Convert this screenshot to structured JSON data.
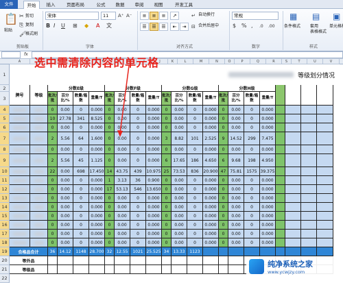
{
  "tabs": {
    "file": "文件",
    "home": "开始",
    "insert": "插入",
    "layout": "页面布局",
    "formula": "公式",
    "data": "数据",
    "review": "审阅",
    "view": "视图",
    "dev": "开发工具"
  },
  "ribbon": {
    "paste": "粘贴",
    "cut": "剪切",
    "copy": "复制",
    "format_painter": "格式刷",
    "clipboard_group": "剪贴板",
    "font_name": "宋体",
    "font_size": "11",
    "font_group": "字体",
    "align_group": "对齐方式",
    "wrap_text": "自动换行",
    "merge_center": "合并后居中",
    "number_format": "常规",
    "number_group": "数字",
    "cond_format": "条件格式",
    "table_format": "套用\n表格格式",
    "cell_style": "单元格样式",
    "styles_group": "样式"
  },
  "formula_bar": {
    "fx": "fx"
  },
  "annotation": "选中需清除内容的单元格",
  "sheet": {
    "title": "等级划分情况",
    "col_brand": "牌号",
    "col_grade": "等级",
    "grade_headers": [
      "分数E级",
      "分数F级",
      "分数G级",
      "分数H级"
    ],
    "sub_headers": [
      "批次/批",
      "百分比/%",
      "数量/箱数",
      "重量/T"
    ],
    "col_letters": [
      "A",
      "B",
      "C",
      "D",
      "E",
      "F",
      "G",
      "H",
      "I",
      "J",
      "K",
      "L",
      "M",
      "N",
      "O",
      "P",
      "Q",
      "R",
      "S",
      "T",
      "U",
      "V"
    ],
    "row_numbers": [
      "1",
      "2",
      "3",
      "4",
      "5",
      "6",
      "7",
      "8",
      "9",
      "10",
      "11",
      "12",
      "13",
      "14",
      "15",
      "16",
      "17",
      "18",
      "19",
      "20",
      "21",
      "22"
    ],
    "rows": [
      [
        "0",
        "0.00",
        "0",
        "0.000",
        "0",
        "0.00",
        "0",
        "0.000",
        "0",
        "0.00",
        "0",
        "0.000",
        "0",
        "0.00",
        "0",
        "0.000"
      ],
      [
        "10",
        "27.78",
        "341",
        "8.525",
        "0",
        "0.00",
        "0",
        "0.000",
        "0",
        "0.00",
        "0",
        "0.000",
        "0",
        "0.00",
        "0",
        "0.000"
      ],
      [
        "0",
        "0.00",
        "0",
        "0.000",
        "0",
        "0.00",
        "0",
        "0.000",
        "0",
        "0.00",
        "0",
        "0.000",
        "0",
        "0.00",
        "0",
        "0.000"
      ],
      [
        "2",
        "5.56",
        "64",
        "1.600",
        "0",
        "0.00",
        "0",
        "0.000",
        "3",
        "8.82",
        "101",
        "2.525",
        "9",
        "14.52",
        "299",
        "7.475"
      ],
      [
        "0",
        "0.00",
        "0",
        "0.000",
        "0",
        "0.00",
        "0",
        "0.000",
        "0",
        "0.00",
        "0",
        "0.000",
        "0",
        "0.00",
        "0",
        "0.000"
      ],
      [
        "2",
        "5.56",
        "45",
        "1.125",
        "0",
        "0.00",
        "0",
        "0.000",
        "6",
        "17.65",
        "186",
        "4.650",
        "6",
        "9.68",
        "198",
        "4.950"
      ],
      [
        "22",
        "0.00",
        "698",
        "17.450",
        "14",
        "43.75",
        "439",
        "10.975",
        "25",
        "73.53",
        "836",
        "20.900",
        "47",
        "75.81",
        "1575",
        "39.375"
      ],
      [
        "0",
        "0.00",
        "0",
        "0.000",
        "1",
        "3.13",
        "36",
        "0.900",
        "0",
        "0.00",
        "0",
        "0.000",
        "0",
        "0.00",
        "0",
        "0.000"
      ],
      [
        "0",
        "0.00",
        "0",
        "0.000",
        "17",
        "53.13",
        "546",
        "13.650",
        "0",
        "0.00",
        "0",
        "0.000",
        "0",
        "0.00",
        "0",
        "0.000"
      ],
      [
        "0",
        "0.00",
        "0",
        "0.000",
        "0",
        "0.00",
        "0",
        "0.000",
        "0",
        "0.00",
        "0",
        "0.000",
        "0",
        "0.00",
        "0",
        "0.000"
      ],
      [
        "0",
        "0.00",
        "0",
        "0.000",
        "0",
        "0.00",
        "0",
        "0.000",
        "0",
        "0.00",
        "0",
        "0.000",
        "0",
        "0.00",
        "0",
        "0.000"
      ],
      [
        "0",
        "0.00",
        "0",
        "0.000",
        "0",
        "0.00",
        "0",
        "0.000",
        "0",
        "0.00",
        "0",
        "0.000",
        "0",
        "0.00",
        "0",
        "0.000"
      ],
      [
        "0",
        "0.00",
        "0",
        "0.000",
        "0",
        "0.00",
        "0",
        "0.000",
        "0",
        "0.00",
        "0",
        "0.000",
        "0",
        "0.00",
        "0",
        "0.000"
      ],
      [
        "0",
        "0.00",
        "0",
        "0.000",
        "0",
        "0.00",
        "0",
        "0.000",
        "0",
        "0.00",
        "0",
        "0.000",
        "0",
        "0.00",
        "0",
        "0.000"
      ],
      [
        "0",
        "0.00",
        "0",
        "0.000",
        "0",
        "0.00",
        "0",
        "0.000",
        "0",
        "0.00",
        "0",
        "0.000",
        "0",
        "0.00",
        "0",
        "0.000"
      ]
    ],
    "totals_label": "合格品合计",
    "totals": [
      "36",
      "14.12",
      "1148",
      "28.700",
      "32",
      "12.55",
      "1021",
      "25.525",
      "34",
      "13.33",
      "1123",
      "",
      "",
      "",
      "",
      ""
    ],
    "row_21_label": "等外品",
    "row_22_label": "等级品"
  },
  "watermark": {
    "line1": "纯净系统之家",
    "line2": "www.ycwjzy.com"
  },
  "colors": {
    "sheet_bg": "#c5d9f1",
    "batch_col": "#7ec36a",
    "header_green": "#8cc66d",
    "highlight": "#f6d98a"
  }
}
